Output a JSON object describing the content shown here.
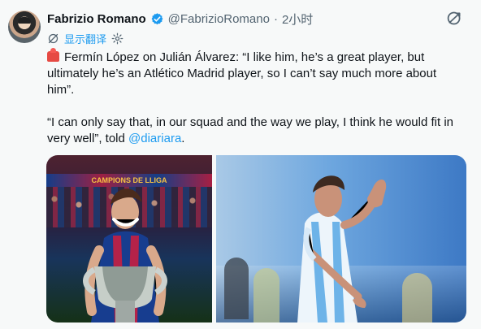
{
  "author": {
    "name": "Fabrizio Romano",
    "handle": "@FabrizioRomano",
    "separator": "·",
    "time": "2小时"
  },
  "actions": {
    "translate_label": "显示翻译"
  },
  "tweet": {
    "line1": "Fermín López on Julián Álvarez: “I like him, he’s a great player, but ultimately he’s an Atlético Madrid player, so I can’t say much more about him”.",
    "line2_prefix": "“I can only say that, in our squad and the way we play, I think he would fit in very well”, told ",
    "mention": "@diariara",
    "line2_suffix": "."
  },
  "media": {
    "left_banner_text": "CAMPIONS DE LLIGA"
  },
  "icons": {
    "verified": "verified-badge-icon",
    "grok": "grok-icon",
    "translate": "translate-icon",
    "settings": "gear-icon",
    "siren": "rotating-light-icon"
  },
  "colors": {
    "accent": "#1d9bf0",
    "background": "#f7f9f9",
    "text": "#0f1419",
    "secondary_text": "#536471"
  }
}
